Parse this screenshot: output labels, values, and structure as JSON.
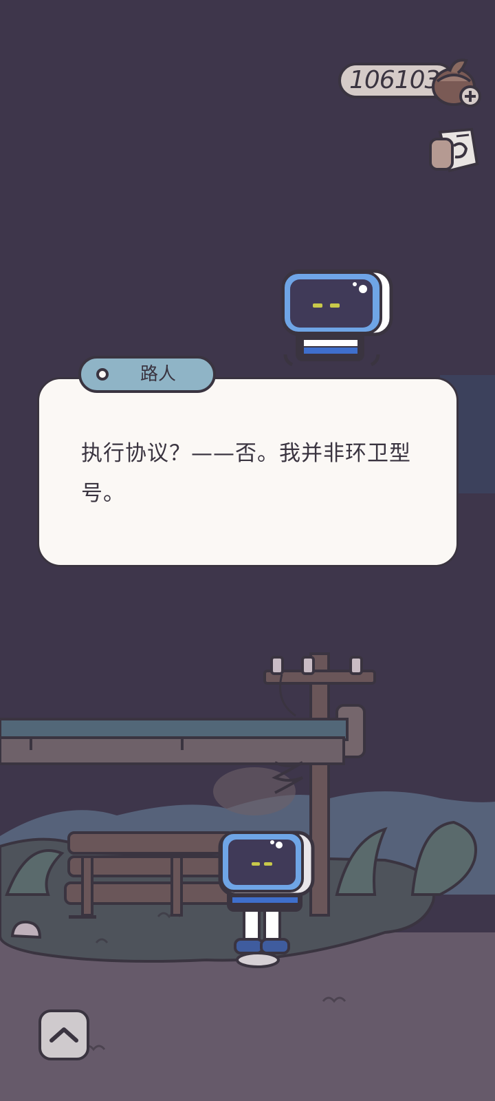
{
  "hud": {
    "coin_count": "106103",
    "coin_icon": "acorn-coin-icon",
    "add_icon": "plus-icon",
    "menu_icon": "newspaper-scroll-icon"
  },
  "dialog": {
    "speaker": "路人",
    "text": "执行协议？——否。我并非环卫型号。"
  },
  "controls": {
    "expand_icon": "chevron-up-icon"
  },
  "colors": {
    "night_sky": "#3e364b",
    "ground": "#665a6a",
    "grass": "#4e535b",
    "dialog_bg": "#fbf8f5",
    "name_tab": "#8fb4c6",
    "robot_screen": "#6fa5e6",
    "robot_eyes": "#c8c94a",
    "outline": "#3a3440"
  }
}
